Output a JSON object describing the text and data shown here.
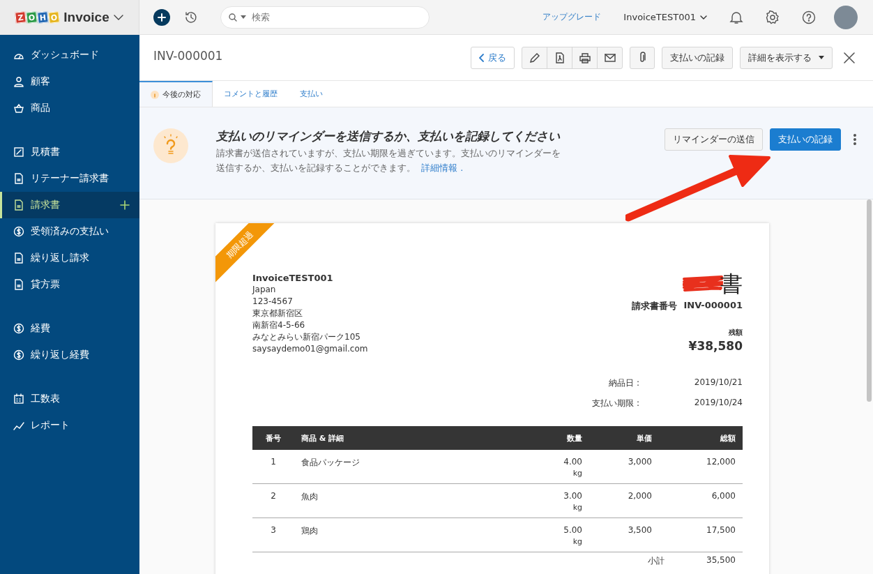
{
  "app": {
    "brand_tiles": [
      "Z",
      "O",
      "H",
      "O"
    ],
    "brand": "Invoice"
  },
  "topbar": {
    "search": {
      "placeholder": "検索"
    },
    "upgrade": "アップグレード",
    "org": "InvoiceTEST001"
  },
  "sidebar": {
    "groups": [
      [
        {
          "kind": "dashboard",
          "label": "ダッシュボード",
          "selected": false
        },
        {
          "kind": "person",
          "label": "顧客",
          "selected": false
        },
        {
          "kind": "basket",
          "label": "商品",
          "selected": false
        }
      ],
      [
        {
          "kind": "estimate",
          "label": "見積書",
          "selected": false
        },
        {
          "kind": "doc",
          "label": "リテーナー請求書",
          "selected": false
        },
        {
          "kind": "doc",
          "label": "請求書",
          "selected": true
        },
        {
          "kind": "coin",
          "label": "受領済みの支払い",
          "selected": false
        },
        {
          "kind": "doc",
          "label": "繰り返し請求",
          "selected": false
        },
        {
          "kind": "doc",
          "label": "貸方票",
          "selected": false
        }
      ],
      [
        {
          "kind": "coin",
          "label": "経費",
          "selected": false
        },
        {
          "kind": "coin",
          "label": "繰り返し経費",
          "selected": false
        }
      ],
      [
        {
          "kind": "calendar",
          "label": "工数表",
          "selected": false
        },
        {
          "kind": "chart",
          "label": "レポート",
          "selected": false
        }
      ]
    ]
  },
  "header": {
    "title": "INV-000001",
    "back": "戻る",
    "record_payment": "支払いの記録",
    "more": "詳細を表示する"
  },
  "tabs": [
    {
      "label": "今後の対応",
      "selected": true
    },
    {
      "label": "コメントと履歴",
      "selected": false
    },
    {
      "label": "支払い",
      "selected": false
    }
  ],
  "banner": {
    "heading": "支払いのリマインダーを送信するか、支払いを記録してください",
    "text": "請求書が送信されていますが、支払い期限を過ぎています。支払いのリマインダーを送信するか、支払いを記録することができます。",
    "link": "詳細情報",
    "link_suffix": ".",
    "reminder_button": "リマインダーの送信",
    "record_button": "支払いの記録"
  },
  "invoice": {
    "ribbon": "期限超過",
    "company": "InvoiceTEST001",
    "address": [
      "Japan",
      "123-4567",
      "東京都新宿区",
      "南新宿4-5-66",
      "みなとみらい新宿パーク105",
      "saysaydemo01@gmail.com"
    ],
    "title": "書",
    "number_label": "請求書番号",
    "number": "INV-000001",
    "balance_label": "残額",
    "balance": "¥38,580",
    "dates": [
      {
        "label": "納品日 :",
        "value": "2019/10/21"
      },
      {
        "label": "支払い期限 :",
        "value": "2019/10/24"
      }
    ],
    "columns": [
      "番号",
      "商品 & 詳細",
      "数量",
      "単価",
      "総額"
    ],
    "rows": [
      {
        "no": "1",
        "item": "食品パッケージ",
        "qty": "4.00",
        "unit": "kg",
        "rate": "3,000",
        "amount": "12,000"
      },
      {
        "no": "2",
        "item": "魚肉",
        "qty": "3.00",
        "unit": "kg",
        "rate": "2,000",
        "amount": "6,000"
      },
      {
        "no": "3",
        "item": "鶏肉",
        "qty": "5.00",
        "unit": "kg",
        "rate": "3,500",
        "amount": "17,500"
      }
    ],
    "subtotal_label": "小計",
    "subtotal": "35,500"
  }
}
